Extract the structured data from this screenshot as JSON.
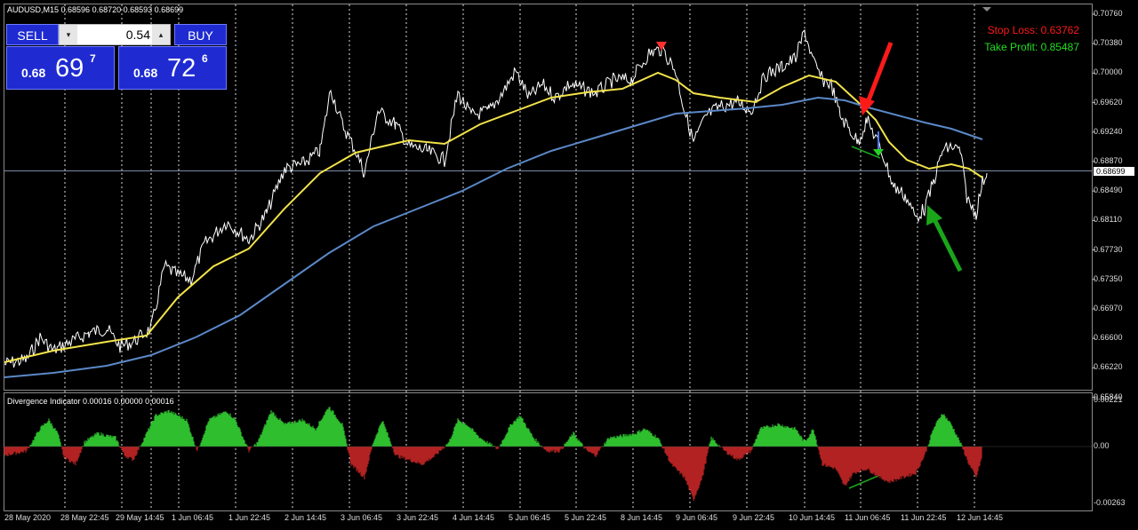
{
  "header": {
    "symbol_text": "AUDUSD,M15",
    "ohlc_text": "0.68596 0.68720 0.68593 0.68699"
  },
  "trade_panel": {
    "sell_label": "SELL",
    "buy_label": "BUY",
    "lot_value": "0.54",
    "sell_price": {
      "prefix": "0.68",
      "main": "69",
      "sup": "7"
    },
    "buy_price": {
      "prefix": "0.68",
      "main": "72",
      "sup": "6"
    },
    "down_arrow": "▾",
    "up_arrow": "▴"
  },
  "annotations": {
    "stop_loss": "Stop Loss: 0.63762",
    "take_profit": "Take Profit: 0.85487",
    "stop_loss_color": "#ff1a1a",
    "take_profit_color": "#22dd22"
  },
  "price_axis": [
    "0.70760",
    "0.70380",
    "0.70000",
    "0.69620",
    "0.69240",
    "0.68870",
    "0.68490",
    "0.68110",
    "0.67730",
    "0.67350",
    "0.66970",
    "0.66600",
    "0.66220",
    "0.65840"
  ],
  "current_price_tag": "0.68699",
  "indicator": {
    "title": "Divergence Indicator 0.00016 0.00000 0.00016",
    "axis": [
      "0.00221",
      "0.00",
      "-0.00263"
    ]
  },
  "time_axis": [
    "28 May 2020",
    "28 May 22:45",
    "29 May 14:45",
    "1 Jun 06:45",
    "1 Jun 22:45",
    "2 Jun 14:45",
    "3 Jun 06:45",
    "3 Jun 22:45",
    "4 Jun 14:45",
    "5 Jun 06:45",
    "5 Jun 22:45",
    "8 Jun 14:45",
    "9 Jun 06:45",
    "9 Jun 22:45",
    "10 Jun 14:45",
    "11 Jun 06:45",
    "11 Jun 22:45",
    "12 Jun 14:45"
  ],
  "colors": {
    "background": "#000000",
    "price_line": "#ffffff",
    "fast_ma": "#f2e34a",
    "slow_ma": "#5b88c8",
    "positive_hist": "#2fbf2f",
    "negative_hist": "#b22222",
    "sell_arrow": "#ff1a1a",
    "buy_arrow": "#1aa51a"
  }
}
